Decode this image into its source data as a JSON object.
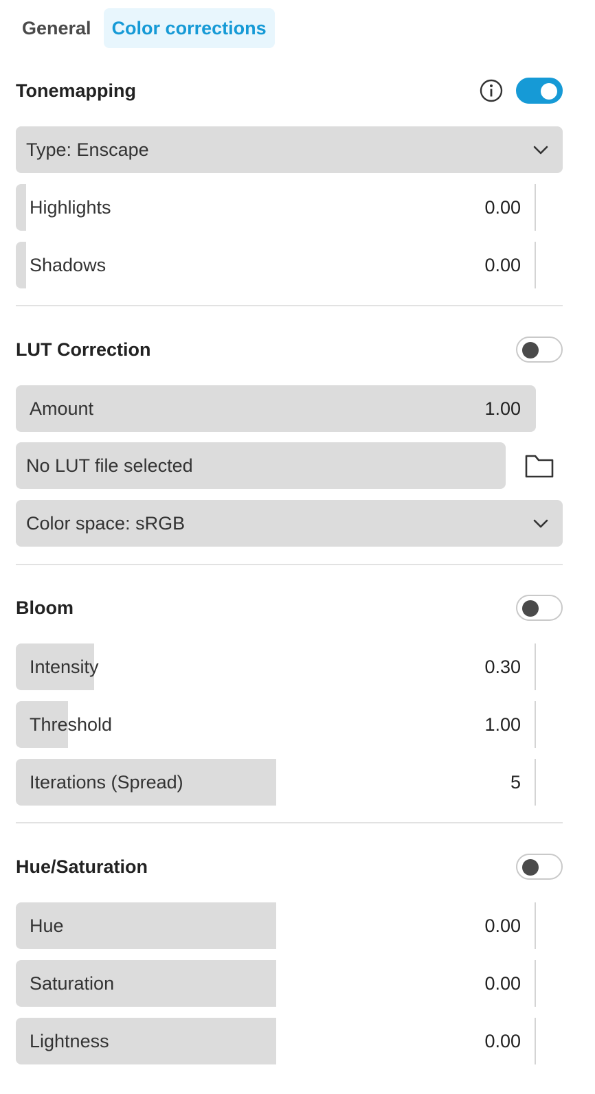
{
  "tabs": [
    {
      "label": "General",
      "active": false
    },
    {
      "label": "Color corrections",
      "active": true
    }
  ],
  "colors": {
    "accent": "#169ad6",
    "tab_active_bg": "#e8f6fd",
    "field_bg": "#dcdcdc"
  },
  "tonemapping": {
    "title": "Tonemapping",
    "enabled": true,
    "info_icon": "info-icon",
    "type_label": "Type: Enscape",
    "highlights": {
      "label": "Highlights",
      "value": "0.00",
      "fill_fraction": 0.02
    },
    "shadows": {
      "label": "Shadows",
      "value": "0.00",
      "fill_fraction": 0.02
    }
  },
  "lut": {
    "title": "LUT Correction",
    "enabled": false,
    "amount": {
      "label": "Amount",
      "value": "1.00",
      "fill_fraction": 1.0
    },
    "file_label": "No LUT file selected",
    "folder_icon": "folder-icon",
    "color_space_label": "Color space: sRGB"
  },
  "bloom": {
    "title": "Bloom",
    "enabled": false,
    "intensity": {
      "label": "Intensity",
      "value": "0.30",
      "fill_fraction": 0.15
    },
    "threshold": {
      "label": "Threshold",
      "value": "1.00",
      "fill_fraction": 0.1
    },
    "iterations": {
      "label": "Iterations (Spread)",
      "value": "5",
      "fill_fraction": 0.5
    }
  },
  "hue_saturation": {
    "title": "Hue/Saturation",
    "enabled": false,
    "hue": {
      "label": "Hue",
      "value": "0.00",
      "fill_fraction": 0.5
    },
    "saturation": {
      "label": "Saturation",
      "value": "0.00",
      "fill_fraction": 0.5
    },
    "lightness": {
      "label": "Lightness",
      "value": "0.00",
      "fill_fraction": 0.5
    }
  }
}
